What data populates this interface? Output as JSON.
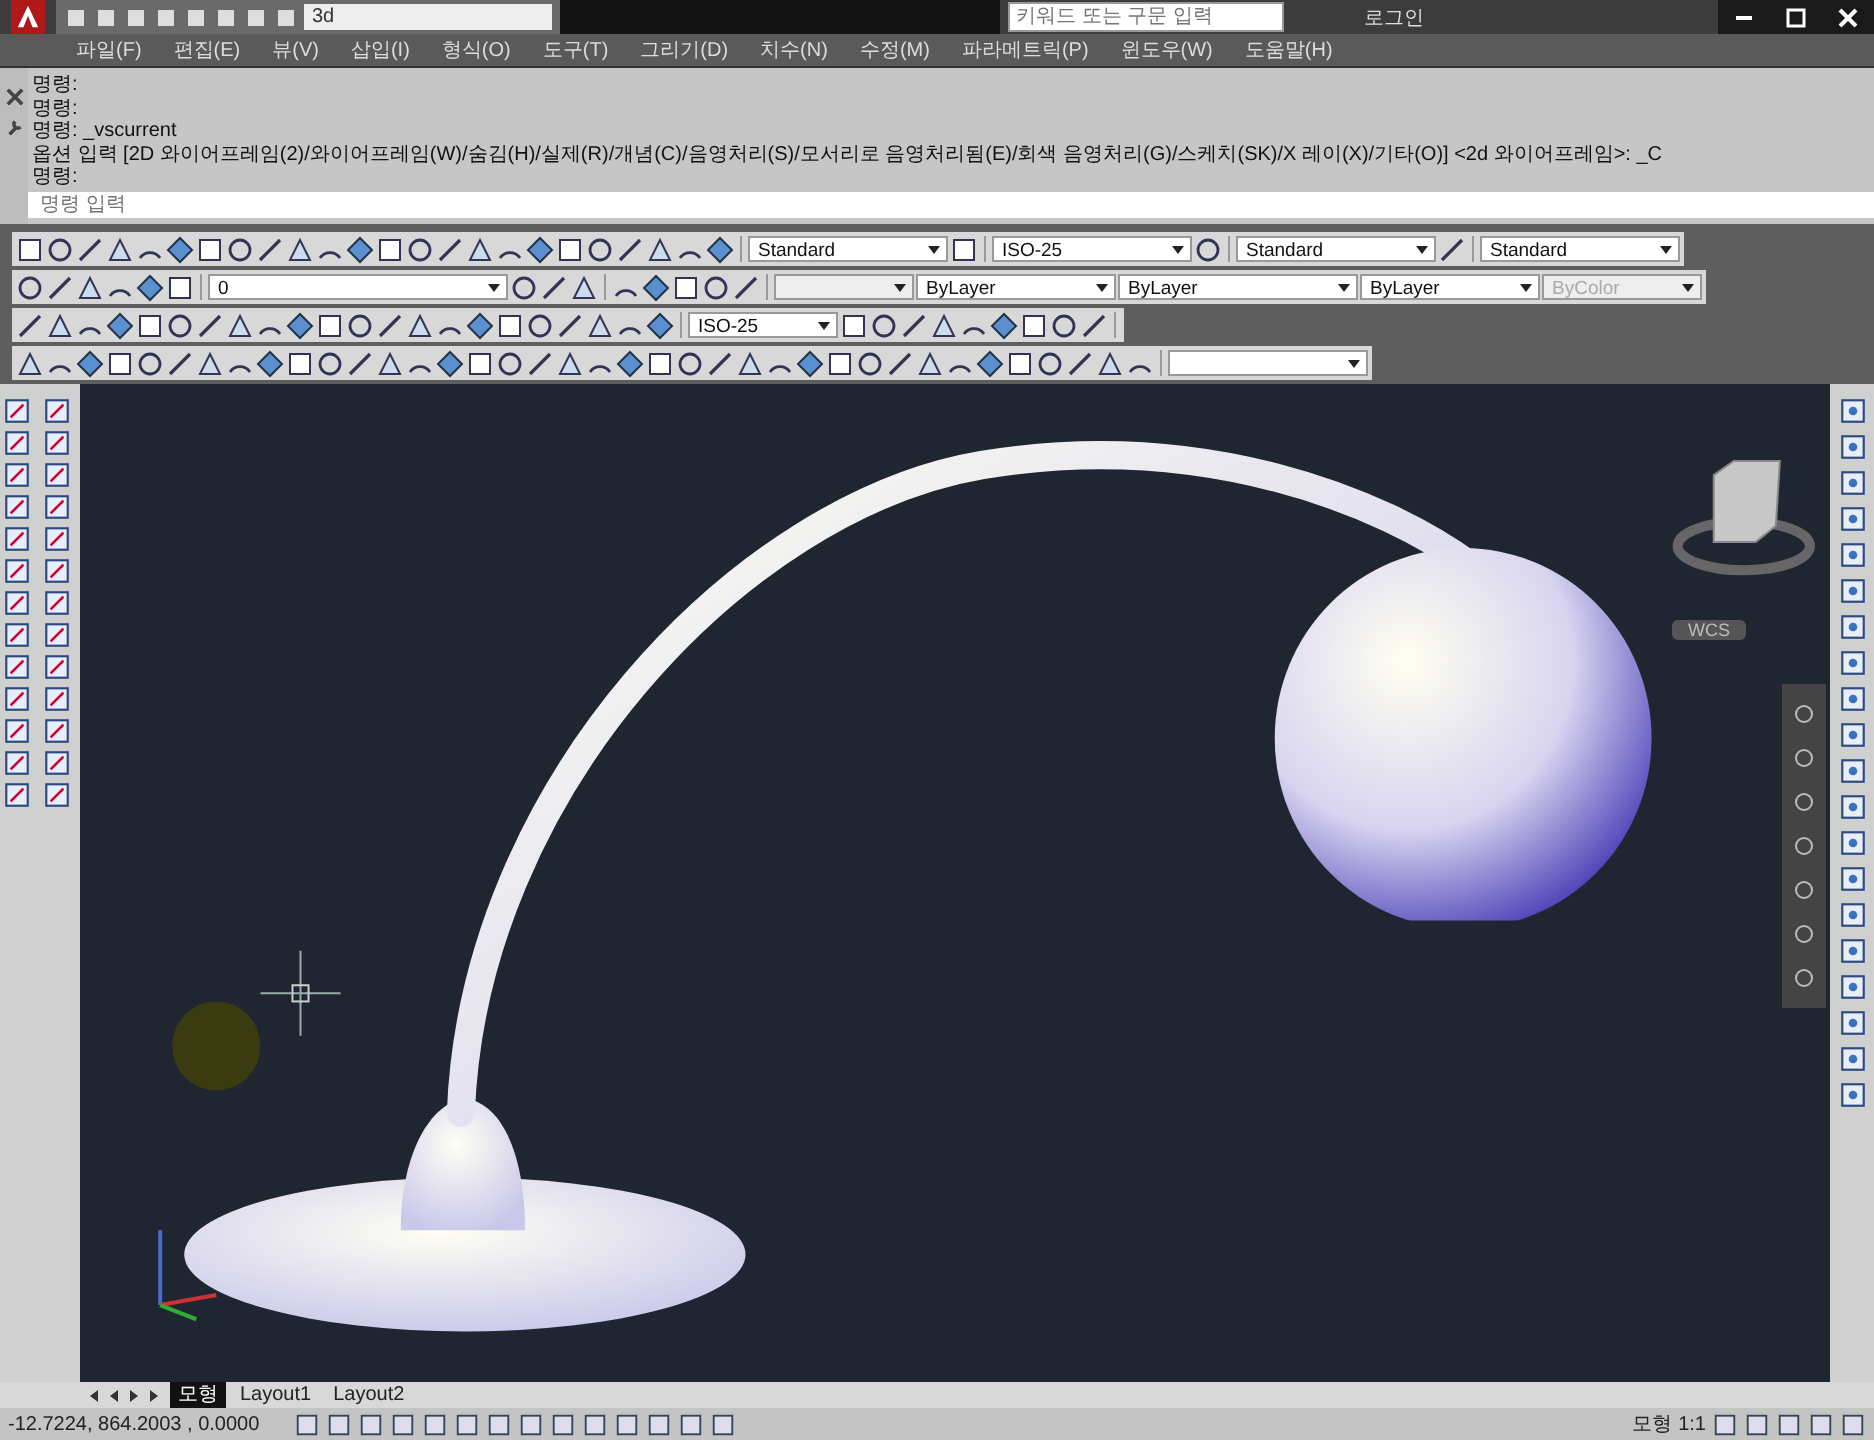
{
  "title_bar": {
    "workspace": "3d",
    "search": {
      "placeholder": "키워드 또는 구문 입력"
    },
    "login": "로그인"
  },
  "menu": [
    "파일(F)",
    "편집(E)",
    "뷰(V)",
    "삽입(I)",
    "형식(O)",
    "도구(T)",
    "그리기(D)",
    "치수(N)",
    "수정(M)",
    "파라메트릭(P)",
    "윈도우(W)",
    "도움말(H)"
  ],
  "command": {
    "history": [
      "명령:",
      "명령:",
      "명령:  _vscurrent",
      "옵션 입력 [2D 와이어프레임(2)/와이어프레임(W)/숨김(H)/실제(R)/개념(C)/음영처리(S)/모서리로 음영처리됨(E)/회색 음영처리(G)/스케치(SK)/X 레이(X)/기타(O)] <2d 와이어프레임>: _C",
      "명령:"
    ],
    "placeholder": "명령 입력"
  },
  "toolbar_rows": [
    {
      "dropdowns": [
        {
          "value": "Standard",
          "disabled": false
        },
        {
          "value": "ISO-25",
          "disabled": false
        },
        {
          "value": "Standard",
          "disabled": false
        },
        {
          "value": "Standard",
          "disabled": false
        }
      ]
    },
    {
      "dropdowns": [
        {
          "value": "0",
          "disabled": false
        },
        {
          "disabled": true
        },
        {
          "value": "ByLayer",
          "disabled": false
        },
        {
          "value": "ByLayer",
          "disabled": false
        },
        {
          "value": "ByLayer",
          "disabled": false
        },
        {
          "value": "ByColor",
          "disabled": true
        }
      ]
    },
    {
      "dropdowns": [
        {
          "value": "ISO-25",
          "disabled": false
        }
      ]
    },
    {
      "dropdowns": [
        {
          "disabled": false
        }
      ]
    }
  ],
  "viewport": {
    "ucs_label": "WCS"
  },
  "layout_tabs": [
    {
      "label": "모형",
      "selected": true
    },
    {
      "label": "Layout1",
      "selected": false
    },
    {
      "label": "Layout2",
      "selected": false
    }
  ],
  "status_bar": {
    "coordinates": "-12.7224, 864.2003 , 0.0000",
    "space": "모형",
    "scale": "1:1"
  }
}
